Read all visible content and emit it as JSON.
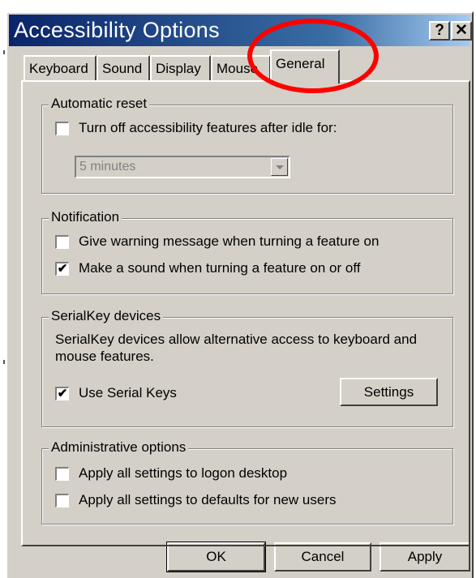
{
  "window": {
    "title": "Accessibility Options"
  },
  "titlebar_buttons": {
    "help": "?",
    "close": "✕"
  },
  "tabs": [
    "Keyboard",
    "Sound",
    "Display",
    "Mouse",
    "General"
  ],
  "active_tab": "General",
  "groups": {
    "automatic_reset": {
      "title": "Automatic reset",
      "checkbox_label": "Turn off accessibility features after idle for:",
      "checked": false,
      "select_value": "5 minutes"
    },
    "notification": {
      "title": "Notification",
      "items": [
        {
          "label": "Give warning message when turning a feature on",
          "checked": false
        },
        {
          "label": "Make a sound when turning a feature on or off",
          "checked": true
        }
      ]
    },
    "serialkey": {
      "title": "SerialKey devices",
      "description": "SerialKey devices allow alternative access to keyboard and mouse features.",
      "checkbox_label": "Use Serial Keys",
      "checked": true,
      "settings_button": "Settings"
    },
    "administrative": {
      "title": "Administrative options",
      "items": [
        {
          "label": "Apply all settings to logon desktop",
          "checked": false
        },
        {
          "label": "Apply all settings to defaults for new users",
          "checked": false
        }
      ]
    }
  },
  "footer": {
    "ok": "OK",
    "cancel": "Cancel",
    "apply": "Apply"
  },
  "check_mark": "✔",
  "colors": {
    "title_bar_start": "#0a246a",
    "title_bar_end": "#a6caf0",
    "face": "#d4d0c8",
    "highlight_circle": "#ff0000"
  }
}
